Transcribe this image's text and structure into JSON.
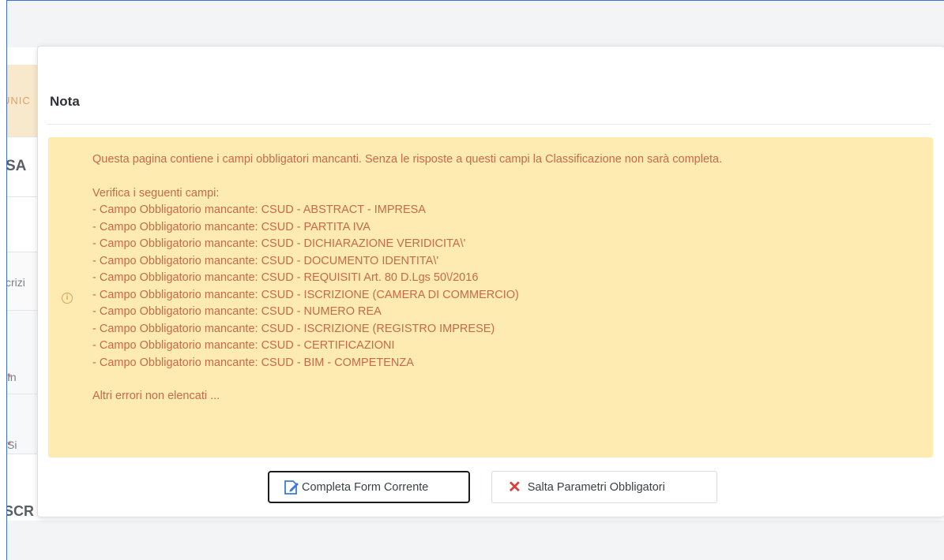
{
  "background": {
    "fragments": {
      "unico": "UNIC",
      "sa": "SA",
      "crizi": "crizi",
      "in": "In",
      "si": "Si",
      "scr": "SCR"
    },
    "required_marker": "*"
  },
  "modal": {
    "title": "Nota",
    "alert": {
      "icon": "info-circle-icon",
      "message": "Questa pagina contiene i campi obbligatori mancanti. Senza le risposte a questi campi la Classificazione non sarà completa.",
      "verify_heading": "Verifica i seguenti campi:",
      "fields": [
        "- Campo Obbligatorio mancante: CSUD - ABSTRACT - IMPRESA",
        "- Campo Obbligatorio mancante: CSUD - PARTITA IVA",
        "- Campo Obbligatorio mancante: CSUD - DICHIARAZIONE VERIDICITA\\'",
        "- Campo Obbligatorio mancante: CSUD - DOCUMENTO IDENTITA\\'",
        "- Campo Obbligatorio mancante: CSUD - REQUISITI Art. 80 D.Lgs 50\\/2016",
        "- Campo Obbligatorio mancante: CSUD - ISCRIZIONE (CAMERA DI COMMERCIO)",
        "- Campo Obbligatorio mancante: CSUD - NUMERO REA",
        "- Campo Obbligatorio mancante: CSUD - ISCRIZIONE (REGISTRO IMPRESE)",
        "- Campo Obbligatorio mancante: CSUD - CERTIFICAZIONI",
        "- Campo Obbligatorio mancante: CSUD - BIM - COMPETENZA"
      ],
      "other_errors": "Altri errori non elencati ..."
    },
    "buttons": {
      "complete": {
        "label": "Completa Form Corrente",
        "icon": "edit-icon"
      },
      "skip": {
        "label": "Salta Parametri Obbligatori",
        "icon": "close-x-icon"
      }
    }
  },
  "colors": {
    "alert_bg": "#fdebb2",
    "alert_text": "#c8694a",
    "skip_icon": "#e03b3b",
    "edit_icon": "#3a7bd5"
  }
}
